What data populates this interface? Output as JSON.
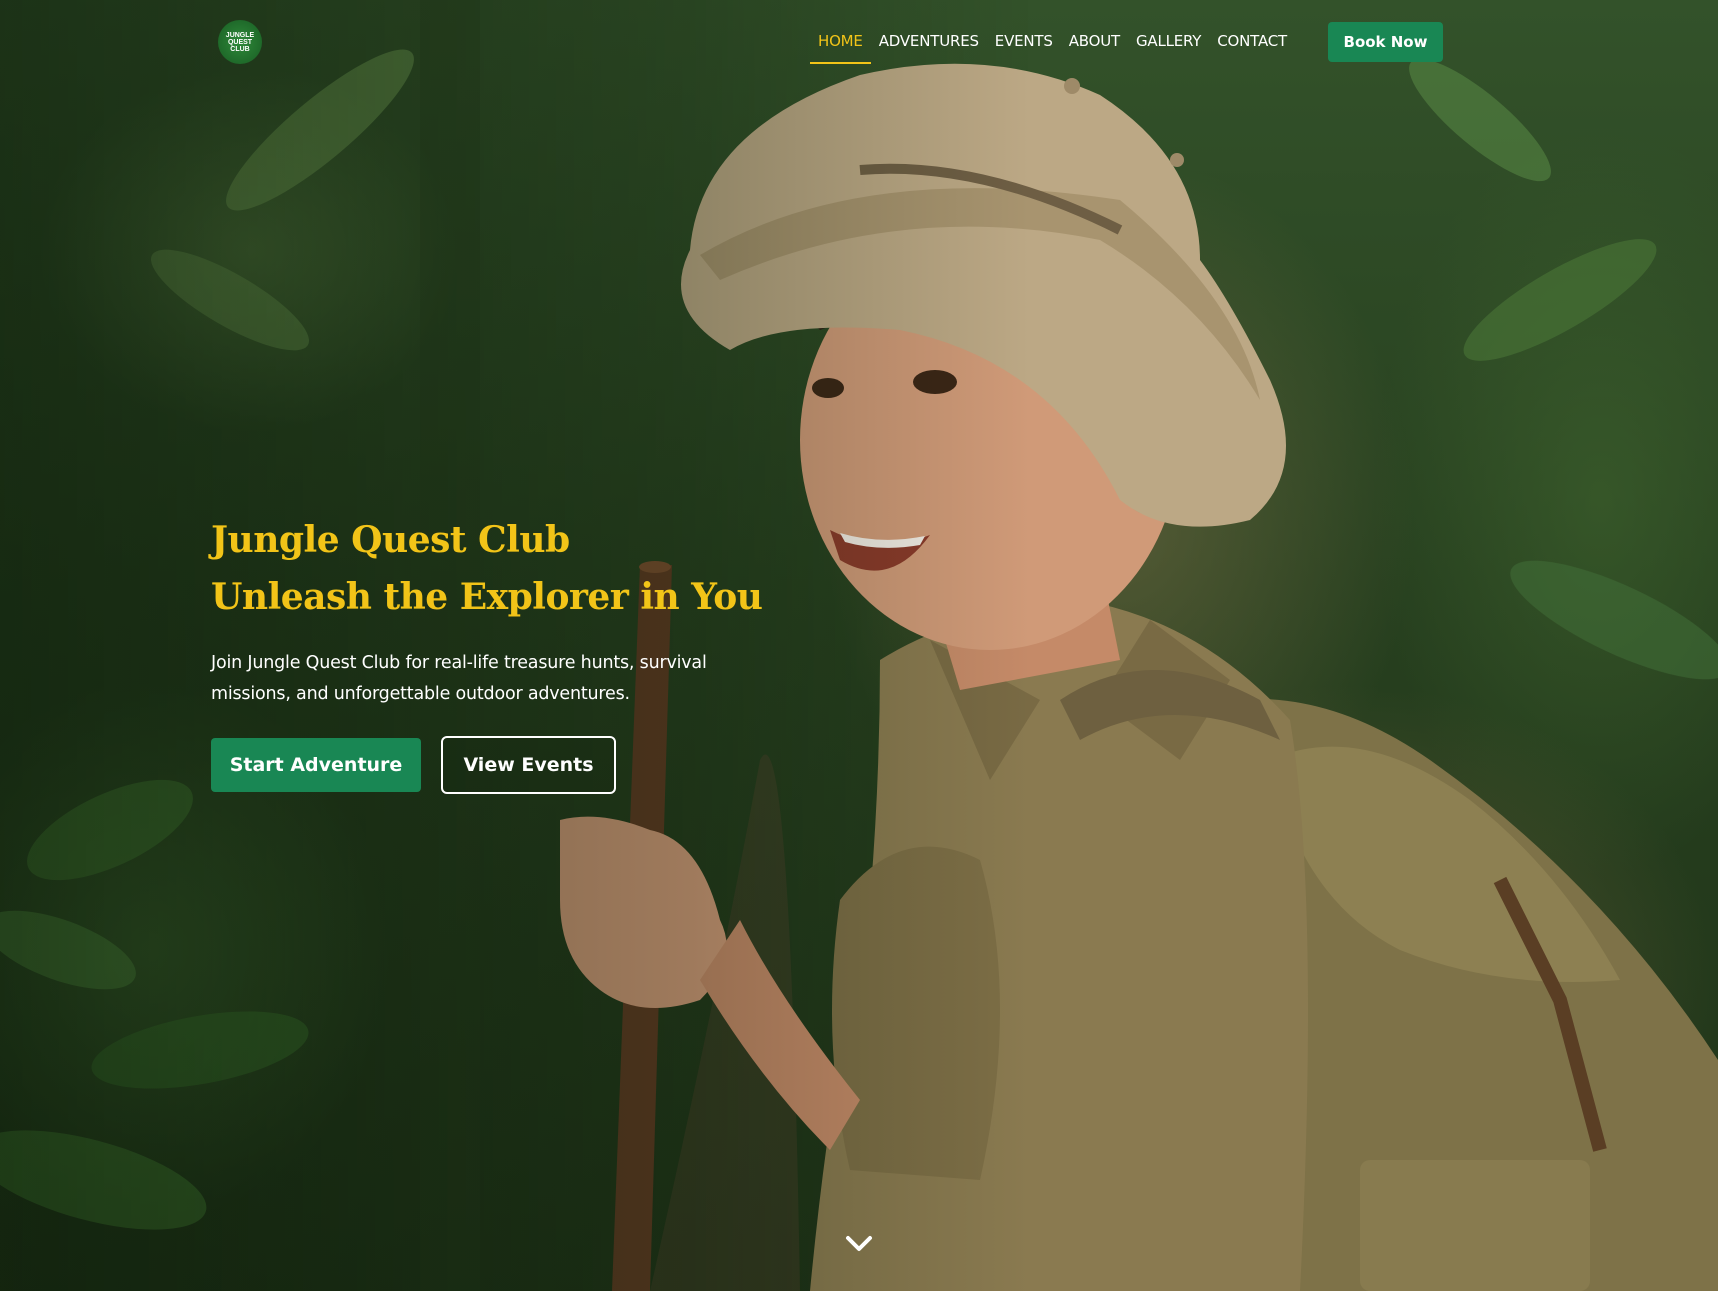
{
  "header": {
    "logo_text": "JUNGLE QUEST CLUB",
    "nav": [
      {
        "label": "HOME",
        "active": true
      },
      {
        "label": "ADVENTURES",
        "active": false
      },
      {
        "label": "EVENTS",
        "active": false
      },
      {
        "label": "ABOUT",
        "active": false
      },
      {
        "label": "GALLERY",
        "active": false
      },
      {
        "label": "CONTACT",
        "active": false
      }
    ],
    "book_label": "Book Now"
  },
  "hero": {
    "title_line1": "Jungle Quest Club",
    "title_line2": "Unleash the Explorer in You",
    "subtitle": "Join Jungle Quest Club for real-life treasure hunts, survival missions, and unforgettable outdoor adventures.",
    "primary_cta": "Start Adventure",
    "secondary_cta": "View Events",
    "scroll_icon": "chevron-down-icon",
    "background_image": "young explorer in pith helmet with walking stick and backpack in jungle"
  },
  "colors": {
    "accent_yellow": "#f2c418",
    "brand_green": "#198754",
    "text_white": "#ffffff"
  }
}
